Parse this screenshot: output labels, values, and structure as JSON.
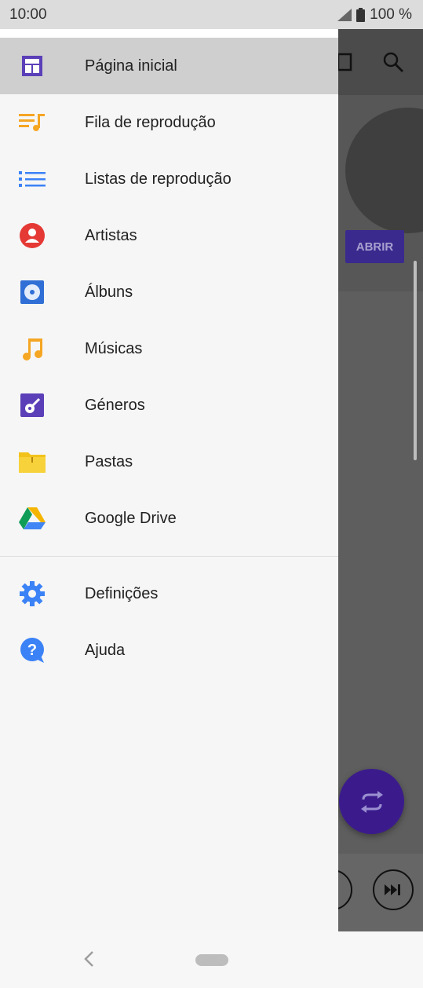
{
  "status_bar": {
    "time": "10:00",
    "battery": "100 %"
  },
  "background": {
    "open_button": "ABRIR"
  },
  "drawer": {
    "items": [
      {
        "label": "Página inicial",
        "icon": "home-icon",
        "active": true
      },
      {
        "label": "Fila de reprodução",
        "icon": "queue-icon"
      },
      {
        "label": "Listas de reprodução",
        "icon": "playlist-icon"
      },
      {
        "label": "Artistas",
        "icon": "artist-icon"
      },
      {
        "label": "Álbuns",
        "icon": "album-icon"
      },
      {
        "label": "Músicas",
        "icon": "music-note-icon"
      },
      {
        "label": "Géneros",
        "icon": "guitar-icon"
      },
      {
        "label": "Pastas",
        "icon": "folder-icon"
      },
      {
        "label": "Google Drive",
        "icon": "google-drive-icon"
      }
    ],
    "secondary_items": [
      {
        "label": "Definições",
        "icon": "settings-gear-icon"
      },
      {
        "label": "Ajuda",
        "icon": "help-icon"
      }
    ]
  },
  "colors": {
    "active_item": "#cfcfcf",
    "accent": "#3b1b8c",
    "queue_orange": "#f5a623",
    "list_blue": "#3b82f6",
    "artist_red": "#e53935",
    "genre_purple": "#5b3fb8"
  }
}
